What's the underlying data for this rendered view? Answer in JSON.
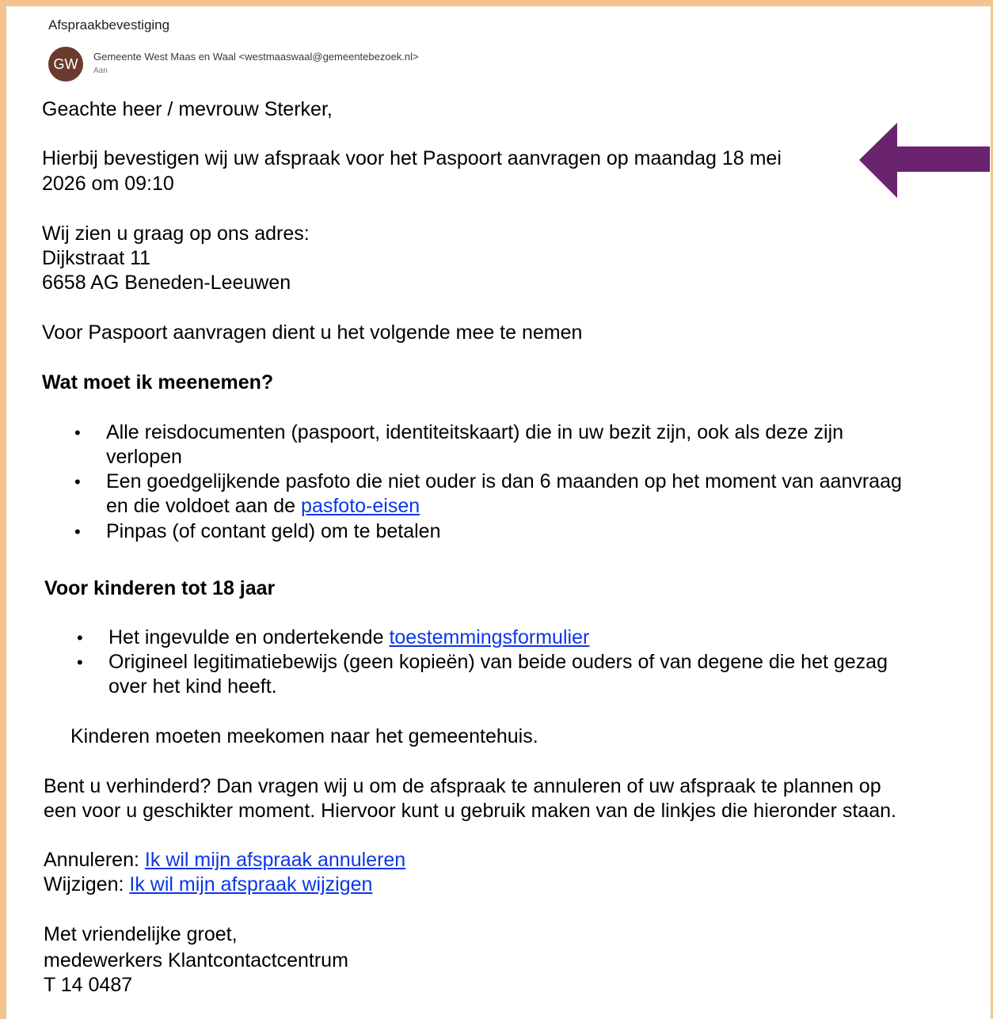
{
  "email": {
    "subject": "Afspraakbevestiging",
    "avatar_initials": "GW",
    "sender": "Gemeente West Maas en Waal <westmaaswaal@gemeentebezoek.nl>",
    "to_label": "Aan"
  },
  "body": {
    "greeting": "Geachte heer / mevrouw Sterker,",
    "confirm_line1": "Hierbij bevestigen wij uw afspraak  voor  het Paspoort aanvragen op maandag 18 mei",
    "confirm_line2": "2026 om 09:10",
    "address_intro": "Wij zien u graag op ons adres:",
    "address_street": "Dijkstraat 11",
    "address_city": "6658 AG Beneden-Leeuwen",
    "bring_intro": "Voor Paspoort aanvragen dient u het volgende mee te nemen",
    "bring_heading": "Wat moet ik meenemen?",
    "bring_items": [
      {
        "line1": "Alle reisdocumenten (paspoort, identiteitskaart) die in uw bezit zijn, ook als deze zijn",
        "line2": "verlopen"
      },
      {
        "line1": "Een goedgelijkende pasfoto die niet ouder is dan 6 maanden op het moment van aanvraag",
        "line2_prefix": "en die voldoet aan de ",
        "line2_link": "pasfoto-eisen"
      },
      {
        "line1": "Pinpas (of contant geld) om te betalen"
      }
    ],
    "kids_heading": "Voor kinderen tot 18 jaar",
    "kids_items": [
      {
        "prefix": "Het ingevulde en ondertekende ",
        "link": "toestemmingsformulier"
      },
      {
        "line1": "Origineel legitimatiebewijs (geen kopieën) van beide ouders of van degene die het gezag",
        "line2": "over het kind heeft."
      }
    ],
    "kids_note": "Kinderen moeten meekomen naar het gemeentehuis.",
    "prevented_line1": "Bent u verhinderd? Dan vragen wij u om de afspraak te annuleren of uw afspraak te plannen op",
    "prevented_line2": "een voor u geschikter moment. Hiervoor kunt u gebruik maken van de linkjes die hieronder staan.",
    "cancel_label": "Annuleren: ",
    "cancel_link": "Ik wil mijn afspraak annuleren",
    "change_label": "Wijzigen: ",
    "change_link": "Ik wil mijn afspraak wijzigen",
    "closing": "Met vriendelijke groet,",
    "signature": "medewerkers Klantcontactcentrum",
    "phone": "T 14 0487"
  },
  "colors": {
    "frame": "#f4c48f",
    "arrow": "#6a236f",
    "link": "#0b36e8",
    "avatar": "#6b3a2e"
  }
}
